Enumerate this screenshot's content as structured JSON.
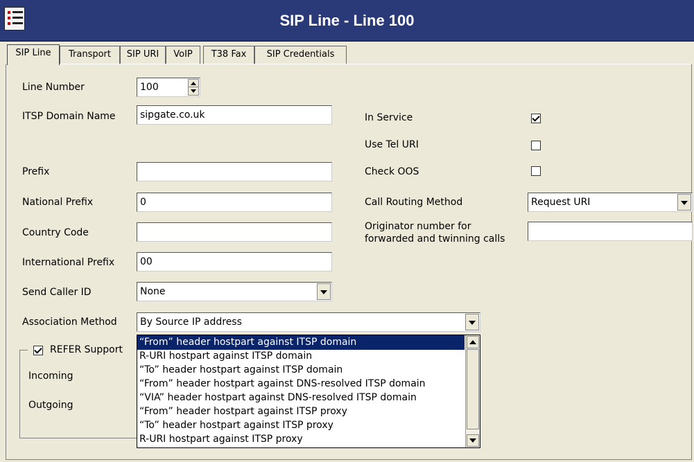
{
  "window": {
    "title": "SIP Line - Line 100"
  },
  "tabs": [
    "SIP Line",
    "Transport",
    "SIP URI",
    "VoIP",
    "T38 Fax",
    "SIP Credentials"
  ],
  "fields": {
    "line_number": {
      "label": "Line Number",
      "value": "100"
    },
    "itsp_domain": {
      "label": "ITSP Domain Name",
      "value": "sipgate.co.uk"
    },
    "prefix": {
      "label": "Prefix",
      "value": ""
    },
    "national_prefix": {
      "label": "National Prefix",
      "value": "0"
    },
    "country_code": {
      "label": "Country Code",
      "value": ""
    },
    "international_prefix": {
      "label": "International Prefix",
      "value": "00"
    },
    "send_caller_id": {
      "label": "Send Caller ID",
      "value": "None"
    },
    "association_method": {
      "label": "Association Method",
      "value": "By Source IP address"
    }
  },
  "right": {
    "in_service": {
      "label": "In Service",
      "checked": true
    },
    "use_tel_uri": {
      "label": "Use Tel URI",
      "checked": false
    },
    "check_oos": {
      "label": "Check OOS",
      "checked": false
    },
    "call_routing": {
      "label": "Call Routing Method",
      "value": "Request URI"
    },
    "originator": {
      "label_line1": "Originator number for",
      "label_line2": "forwarded and twinning calls",
      "value": ""
    }
  },
  "refer": {
    "label": "REFER Support",
    "checked": true,
    "incoming": "Incoming",
    "outgoing": "Outgoing"
  },
  "association_options": [
    "“From” header hostpart against ITSP domain",
    "R-URI hostpart against ITSP domain",
    "“To” header hostpart against ITSP domain",
    "“From” header hostpart against DNS-resolved ITSP domain",
    "“VIA” header hostpart against DNS-resolved ITSP domain",
    "“From” header hostpart against ITSP proxy",
    "“To” header hostpart against ITSP proxy",
    "R-URI hostpart against ITSP proxy"
  ],
  "colors": {
    "titlebar": "#2a3a78",
    "selection": "#0a246a",
    "background": "#ece9d8"
  }
}
